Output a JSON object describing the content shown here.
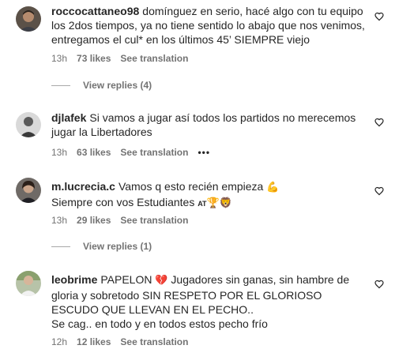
{
  "comments": [
    {
      "username": "roccocattaneo98",
      "text": "domínguez en serio, hacé algo con tu equipo los 2dos tiempos, ya no tiene sentido lo abajo que nos venimos, entregamos el cul* en los últimos 45’ SIEMPRE viejo",
      "time": "13h",
      "likes": "73 likes",
      "translate": "See translation",
      "replies": "View replies (4)"
    },
    {
      "username": "djlafek",
      "text": "Si vamos a jugar así todos los partidos no merecemos jugar la Libertadores",
      "time": "13h",
      "likes": "63 likes",
      "translate": "See translation",
      "more": "•••"
    },
    {
      "username": "m.lucrecia.c",
      "text_line1": "Vamos q esto recién empieza",
      "emoji1": "💪",
      "text_line2": "Siempre con vos Estudiantes",
      "tag": "AT",
      "emoji2": "🏆",
      "emoji3": "🦁",
      "time": "13h",
      "likes": "29 likes",
      "translate": "See translation",
      "replies": "View replies (1)"
    },
    {
      "username": "leobrime",
      "text_pre": "PAPELON",
      "emoji_heart": "💔",
      "text_post": " Jugadores sin ganas, sin hambre de gloria y sobretodo SIN RESPETO POR EL GLORIOSO ESCUDO QUE LLEVAN EN EL PECHO..\nSe cag.. en todo y en todos estos pecho frío",
      "time": "12h",
      "likes": "12 likes",
      "translate": "See translation"
    }
  ],
  "colors": {
    "text": "#262626",
    "secondary": "#737373",
    "heart_emoji": "#d4172a"
  }
}
